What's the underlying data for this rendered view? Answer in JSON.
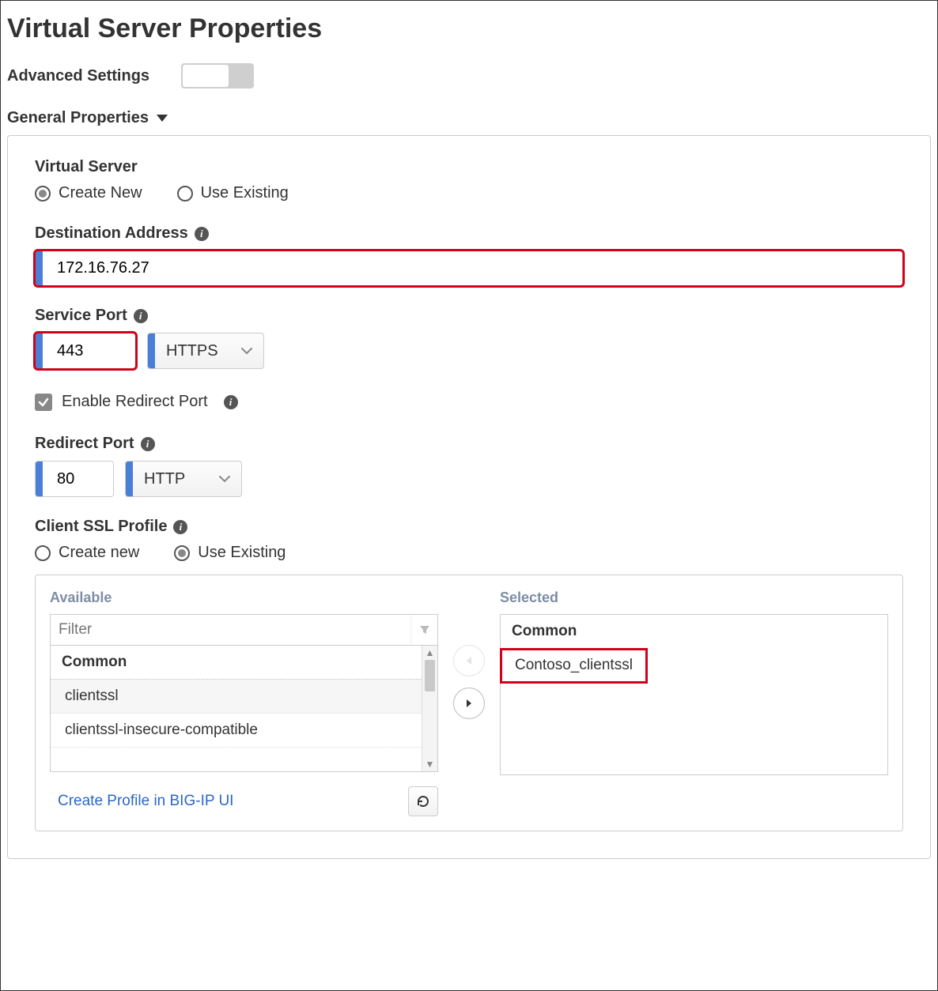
{
  "page": {
    "title": "Virtual Server Properties",
    "advanced_settings_label": "Advanced Settings",
    "advanced_settings_on": false
  },
  "section": {
    "general_properties_label": "General Properties"
  },
  "virtual_server": {
    "label": "Virtual Server",
    "create_new_label": "Create New",
    "use_existing_label": "Use Existing",
    "selected": "create_new"
  },
  "destination": {
    "label": "Destination Address",
    "value": "172.16.76.27"
  },
  "service_port": {
    "label": "Service Port",
    "value": "443",
    "protocol": "HTTPS"
  },
  "redirect": {
    "enable_label": "Enable Redirect Port",
    "enabled": true,
    "port_label": "Redirect Port",
    "port_value": "80",
    "protocol": "HTTP"
  },
  "client_ssl": {
    "label": "Client SSL Profile",
    "create_new_label": "Create new",
    "use_existing_label": "Use Existing",
    "selected": "use_existing",
    "available_label": "Available",
    "selected_label": "Selected",
    "filter_placeholder": "Filter",
    "available_group": "Common",
    "available_items": [
      "clientssl",
      "clientssl-insecure-compatible"
    ],
    "selected_group": "Common",
    "selected_items": [
      "Contoso_clientssl"
    ],
    "create_profile_link": "Create Profile in BIG-IP UI"
  },
  "colors": {
    "accent_blue": "#4a7fd7",
    "highlight_red": "#d0021b"
  }
}
